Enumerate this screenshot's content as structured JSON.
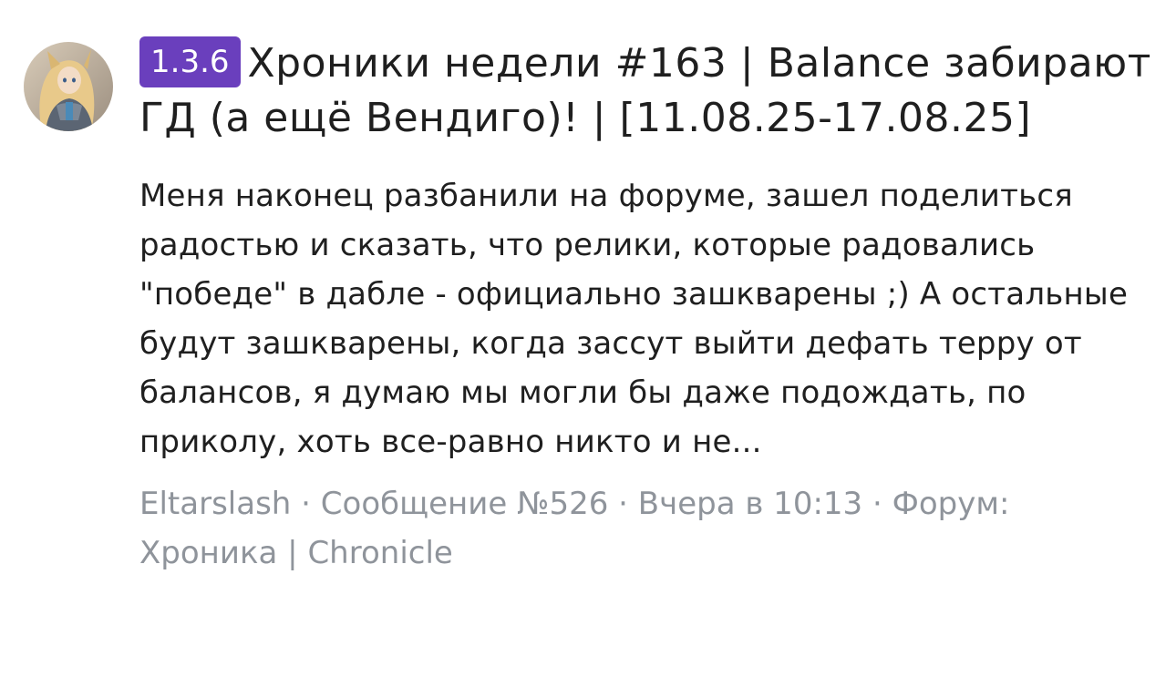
{
  "result": {
    "avatar_icon": "user-avatar",
    "prefix": "1.3.6",
    "title": "Хроники недели #163 | Balance забирают ГД (а ещё Вендиго)! | [11.08.25-17.08.25]",
    "snippet": "Меня наконец разбанили на форуме, зашел поделиться радостью и сказать, что релики, которые радовались \"победе\" в дабле - официально зашкварены ;) А остальные будут зашкварены, когда зассут выйти дефать терру от балансов, я думаю мы могли бы даже подождать, по приколу, хоть все-равно никто и не...",
    "meta": {
      "author": "Eltarslash",
      "separator": " · ",
      "message": "Сообщение №526",
      "time": "Вчера в 10:13",
      "forum_label": "Форум:",
      "forum_name": "Хроника | Chronicle"
    },
    "colors": {
      "badge": "#6a3fbd",
      "meta": "#8f949b",
      "text": "#1f1f1f"
    }
  }
}
